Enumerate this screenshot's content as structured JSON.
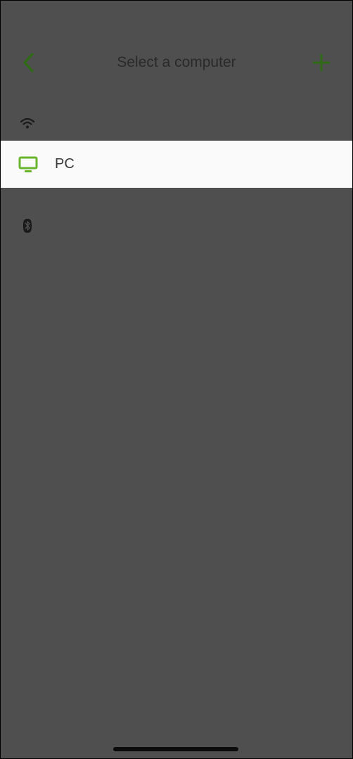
{
  "header": {
    "title": "Select a computer",
    "back_icon": "chevron-left-icon",
    "add_icon": "plus-icon"
  },
  "sections": {
    "wifi": {
      "icon": "wifi-icon"
    },
    "bluetooth": {
      "icon": "bluetooth-icon"
    }
  },
  "computers": [
    {
      "label": "PC",
      "icon": "monitor-icon"
    }
  ],
  "colors": {
    "accent": "#2f6a14",
    "monitor_icon": "#6ab42c",
    "overlay_background": "#4f4f4f",
    "row_background": "#fafafa",
    "title_text": "#2a2a2a"
  }
}
